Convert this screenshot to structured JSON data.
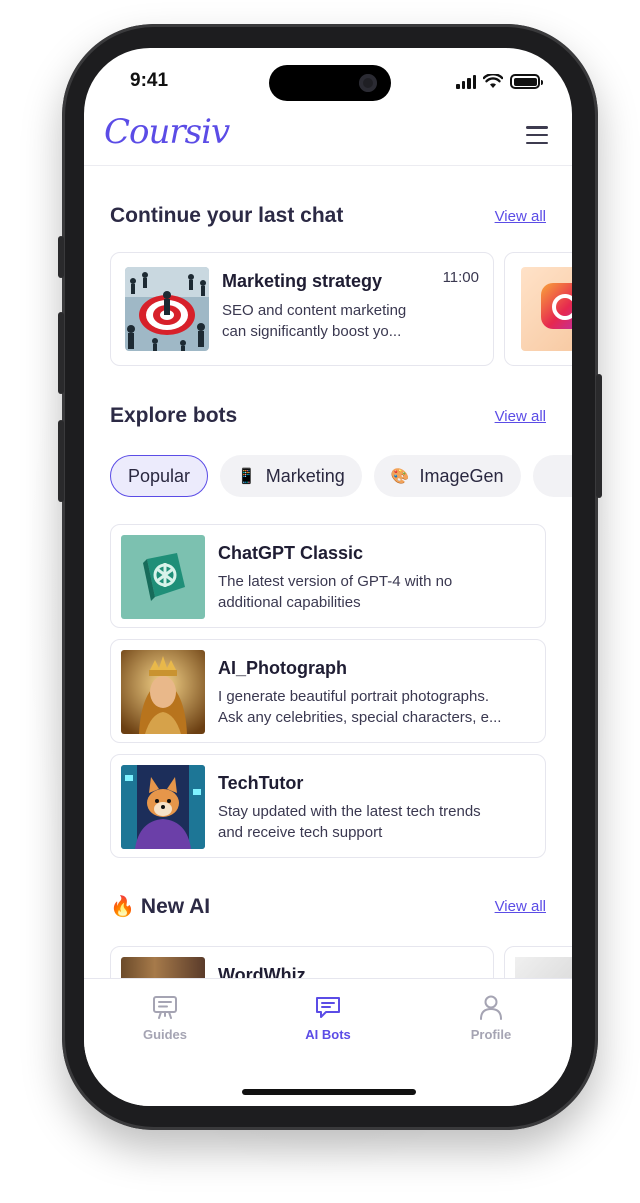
{
  "status_bar": {
    "time": "9:41"
  },
  "header": {
    "logo": "Coursiv",
    "menu_icon": "hamburger-menu-icon"
  },
  "continue_chat": {
    "title": "Continue your last chat",
    "view_all": "View all",
    "cards": [
      {
        "title": "Marketing strategy",
        "time": "11:00",
        "desc_line1": "SEO and content marketing",
        "desc_line2": "can significantly boost yo..."
      }
    ]
  },
  "explore_bots": {
    "title": "Explore bots",
    "view_all": "View all",
    "pills": [
      {
        "label": "Popular",
        "icon": ""
      },
      {
        "label": "Marketing",
        "icon": "📱"
      },
      {
        "label": "ImageGen",
        "icon": "🎨"
      }
    ],
    "bots": [
      {
        "title": "ChatGPT Classic",
        "desc_line1": "The latest version of GPT-4 with no",
        "desc_line2": "additional capabilities"
      },
      {
        "title": "AI_Photograph",
        "desc_line1": "I generate beautiful portrait photographs.",
        "desc_line2": "Ask any celebrities, special characters, e..."
      },
      {
        "title": "TechTutor",
        "desc_line1": "Stay updated with the latest tech trends",
        "desc_line2": "and receive tech support"
      }
    ]
  },
  "new_ai": {
    "icon": "🔥",
    "title": "New AI",
    "view_all": "View all",
    "cards": [
      {
        "title": "WordWhiz"
      }
    ]
  },
  "bottom_nav": {
    "items": [
      {
        "label": "Guides",
        "icon": "guides-icon",
        "active": false
      },
      {
        "label": "AI Bots",
        "icon": "chat-icon",
        "active": true
      },
      {
        "label": "Profile",
        "icon": "profile-icon",
        "active": false
      }
    ]
  },
  "colors": {
    "accent": "#5b4ce6",
    "text": "#2c2a45",
    "muted": "#a5a4b3"
  }
}
